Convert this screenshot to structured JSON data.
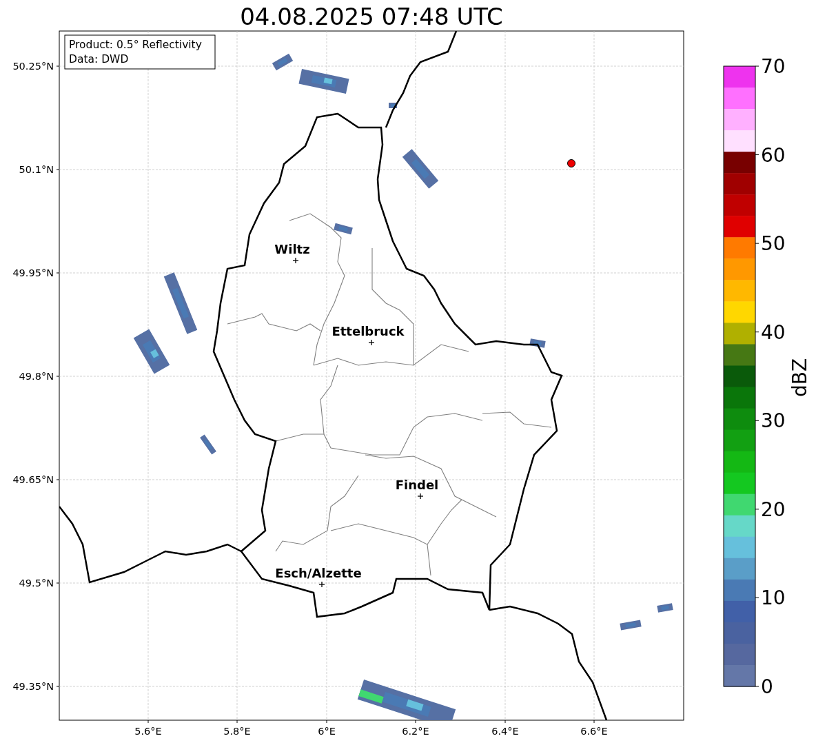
{
  "title": "04.08.2025 07:48 UTC",
  "info_box": [
    "Product: 0.5° Reflectivity",
    "Data: DWD"
  ],
  "y_ticks": [
    "50.25°N",
    "50.1°N",
    "49.95°N",
    "49.8°N",
    "49.65°N",
    "49.5°N",
    "49.35°N"
  ],
  "x_ticks": [
    "5.6°E",
    "5.8°E",
    "6°E",
    "6.2°E",
    "6.4°E",
    "6.6°E"
  ],
  "cities": [
    "Wiltz",
    "Ettelbruck",
    "Findel",
    "Esch/Alzette"
  ],
  "colorbar": {
    "label": "dBZ",
    "ticks": [
      "70",
      "60",
      "50",
      "40",
      "30",
      "20",
      "10",
      "0"
    ],
    "bands": [
      {
        "color": "#ee33ee"
      },
      {
        "color": "#ff70ff"
      },
      {
        "color": "#ffb0ff"
      },
      {
        "color": "#ffe0ff"
      },
      {
        "color": "#780000"
      },
      {
        "color": "#a00000"
      },
      {
        "color": "#c00000"
      },
      {
        "color": "#e00000"
      },
      {
        "color": "#ff7a00"
      },
      {
        "color": "#ff9800"
      },
      {
        "color": "#ffb800"
      },
      {
        "color": "#ffd700"
      },
      {
        "color": "#b0b000"
      },
      {
        "color": "#467814"
      },
      {
        "color": "#0a5a0a"
      },
      {
        "color": "#0a760a"
      },
      {
        "color": "#0e8c0e"
      },
      {
        "color": "#12a012"
      },
      {
        "color": "#14b814"
      },
      {
        "color": "#14c820"
      },
      {
        "color": "#40d870"
      },
      {
        "color": "#66d8c8"
      },
      {
        "color": "#66c0dc"
      },
      {
        "color": "#5a9ec8"
      },
      {
        "color": "#4a7ab4"
      },
      {
        "color": "#4160a8"
      },
      {
        "color": "#4a62a0"
      },
      {
        "color": "#56689f"
      },
      {
        "color": "#6477a8"
      }
    ]
  }
}
